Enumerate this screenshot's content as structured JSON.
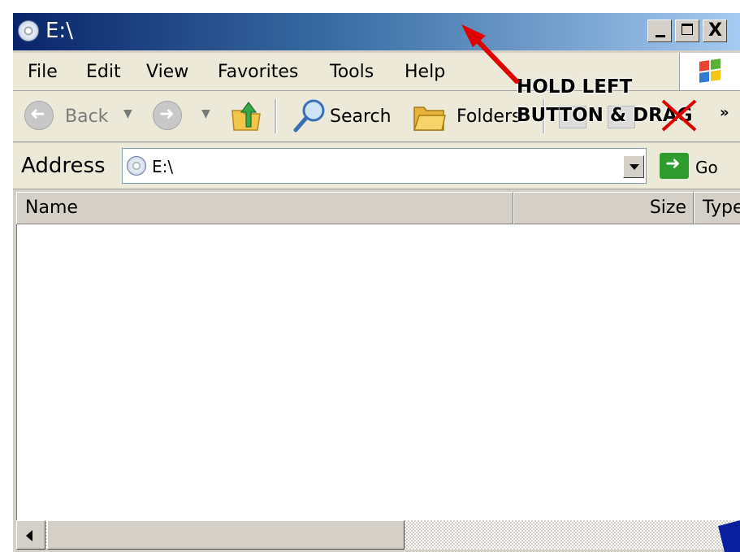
{
  "window": {
    "title": "E:\\",
    "buttons": {
      "minimize": "_",
      "maximize": "□",
      "close": "X"
    }
  },
  "menu": {
    "items": [
      {
        "label": "File"
      },
      {
        "label": "Edit"
      },
      {
        "label": "View"
      },
      {
        "label": "Favorites"
      },
      {
        "label": "Tools"
      },
      {
        "label": "Help"
      }
    ]
  },
  "toolbar": {
    "back_label": "Back",
    "search_label": "Search",
    "folders_label": "Folders",
    "overflow": "»"
  },
  "address": {
    "label": "Address",
    "value": "E:\\",
    "go_label": "Go"
  },
  "list": {
    "columns": [
      {
        "label": "Name"
      },
      {
        "label": "Size"
      },
      {
        "label": "Type"
      }
    ]
  },
  "annotation": {
    "line1": "HOLD LEFT",
    "line2": "BUTTON & DRAG",
    "arrow_color": "#e00000",
    "cursor_color": "#0a1fa0"
  },
  "colors": {
    "title_gradient_start": "#0a246a",
    "title_gradient_end": "#a6caf0",
    "chrome": "#ece9d8",
    "go_green": "#2e9c2e"
  }
}
